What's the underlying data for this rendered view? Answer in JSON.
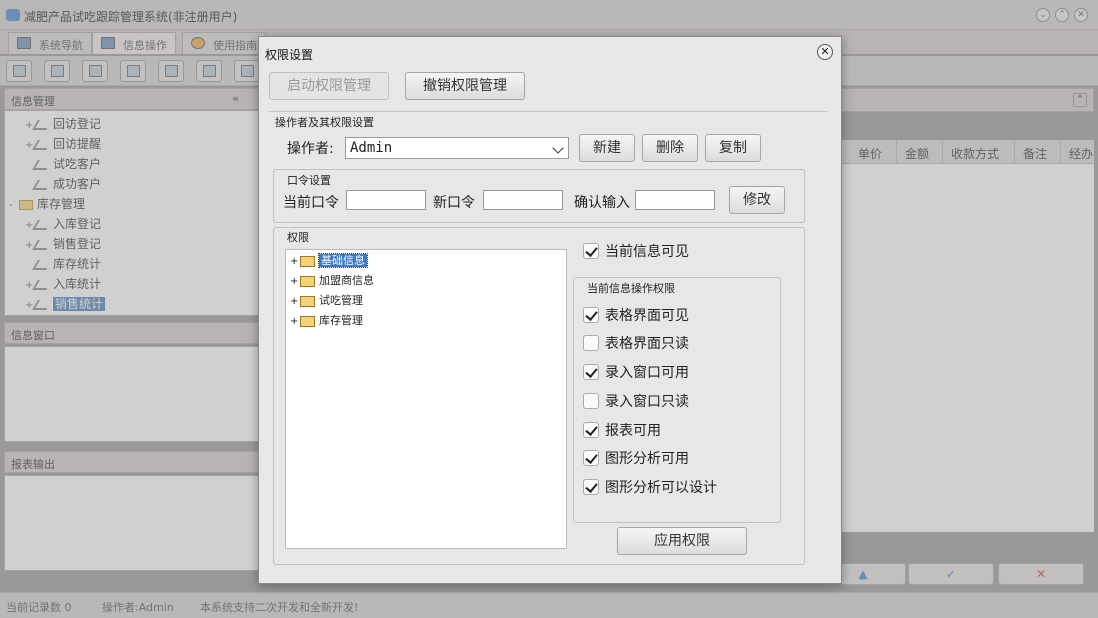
{
  "app": {
    "title": "减肥产品试吃跟踪管理系统(非注册用户)",
    "tabs": [
      {
        "label": "系统导航"
      },
      {
        "label": "信息操作"
      },
      {
        "label": "使用指南"
      }
    ]
  },
  "left": {
    "info_header": "信息管理",
    "tree": [
      {
        "label": "回访登记",
        "expand": "+"
      },
      {
        "label": "回访提醒",
        "expand": "+"
      },
      {
        "label": "试吃客户",
        "expand": ""
      },
      {
        "label": "成功客户",
        "expand": ""
      },
      {
        "label": "库存管理",
        "expand": "-"
      },
      {
        "label": "入库登记",
        "expand": "+"
      },
      {
        "label": "销售登记",
        "expand": "+"
      },
      {
        "label": "库存统计",
        "expand": ""
      },
      {
        "label": "入库统计",
        "expand": "+"
      },
      {
        "label": "销售统计",
        "expand": "+",
        "selected": true
      }
    ],
    "info_window_header": "信息窗口",
    "report_header": "报表输出"
  },
  "grid": {
    "columns": [
      "单价",
      "金额",
      "收款方式",
      "备注",
      "经办"
    ]
  },
  "nav_buttons": [
    "▲",
    "✓",
    "✕"
  ],
  "status": {
    "records": "当前记录数 0",
    "operator": "操作者:Admin",
    "note": "本系统支持二次开发和全新开发!"
  },
  "dialog": {
    "title": "权限设置",
    "close": "✕",
    "enable_btn": "启动权限管理",
    "revoke_btn": "撤销权限管理",
    "op_group_label": "操作者及其权限设置",
    "operator_label": "操作者:",
    "operator_value": "Admin",
    "new_btn": "新建",
    "delete_btn": "删除",
    "copy_btn": "复制",
    "pwd_group_label": "口令设置",
    "current_pwd_label": "当前口令",
    "new_pwd_label": "新口令",
    "confirm_label": "确认输入",
    "modify_btn": "修改",
    "perm_group_label": "权限",
    "perm_tree": [
      {
        "label": "基础信息",
        "selected": true
      },
      {
        "label": "加盟商信息"
      },
      {
        "label": "试吃管理"
      },
      {
        "label": "库存管理"
      }
    ],
    "visible_label": "当前信息可见",
    "visible_checked": true,
    "ops_group_label": "当前信息操作权限",
    "ops": [
      {
        "label": "表格界面可见",
        "checked": true
      },
      {
        "label": "表格界面只读",
        "checked": false
      },
      {
        "label": "录入窗口可用",
        "checked": true
      },
      {
        "label": "录入窗口只读",
        "checked": false
      },
      {
        "label": "报表可用",
        "checked": true
      },
      {
        "label": "图形分析可用",
        "checked": true
      },
      {
        "label": "图形分析可以设计",
        "checked": true
      }
    ],
    "apply_btn": "应用权限"
  }
}
